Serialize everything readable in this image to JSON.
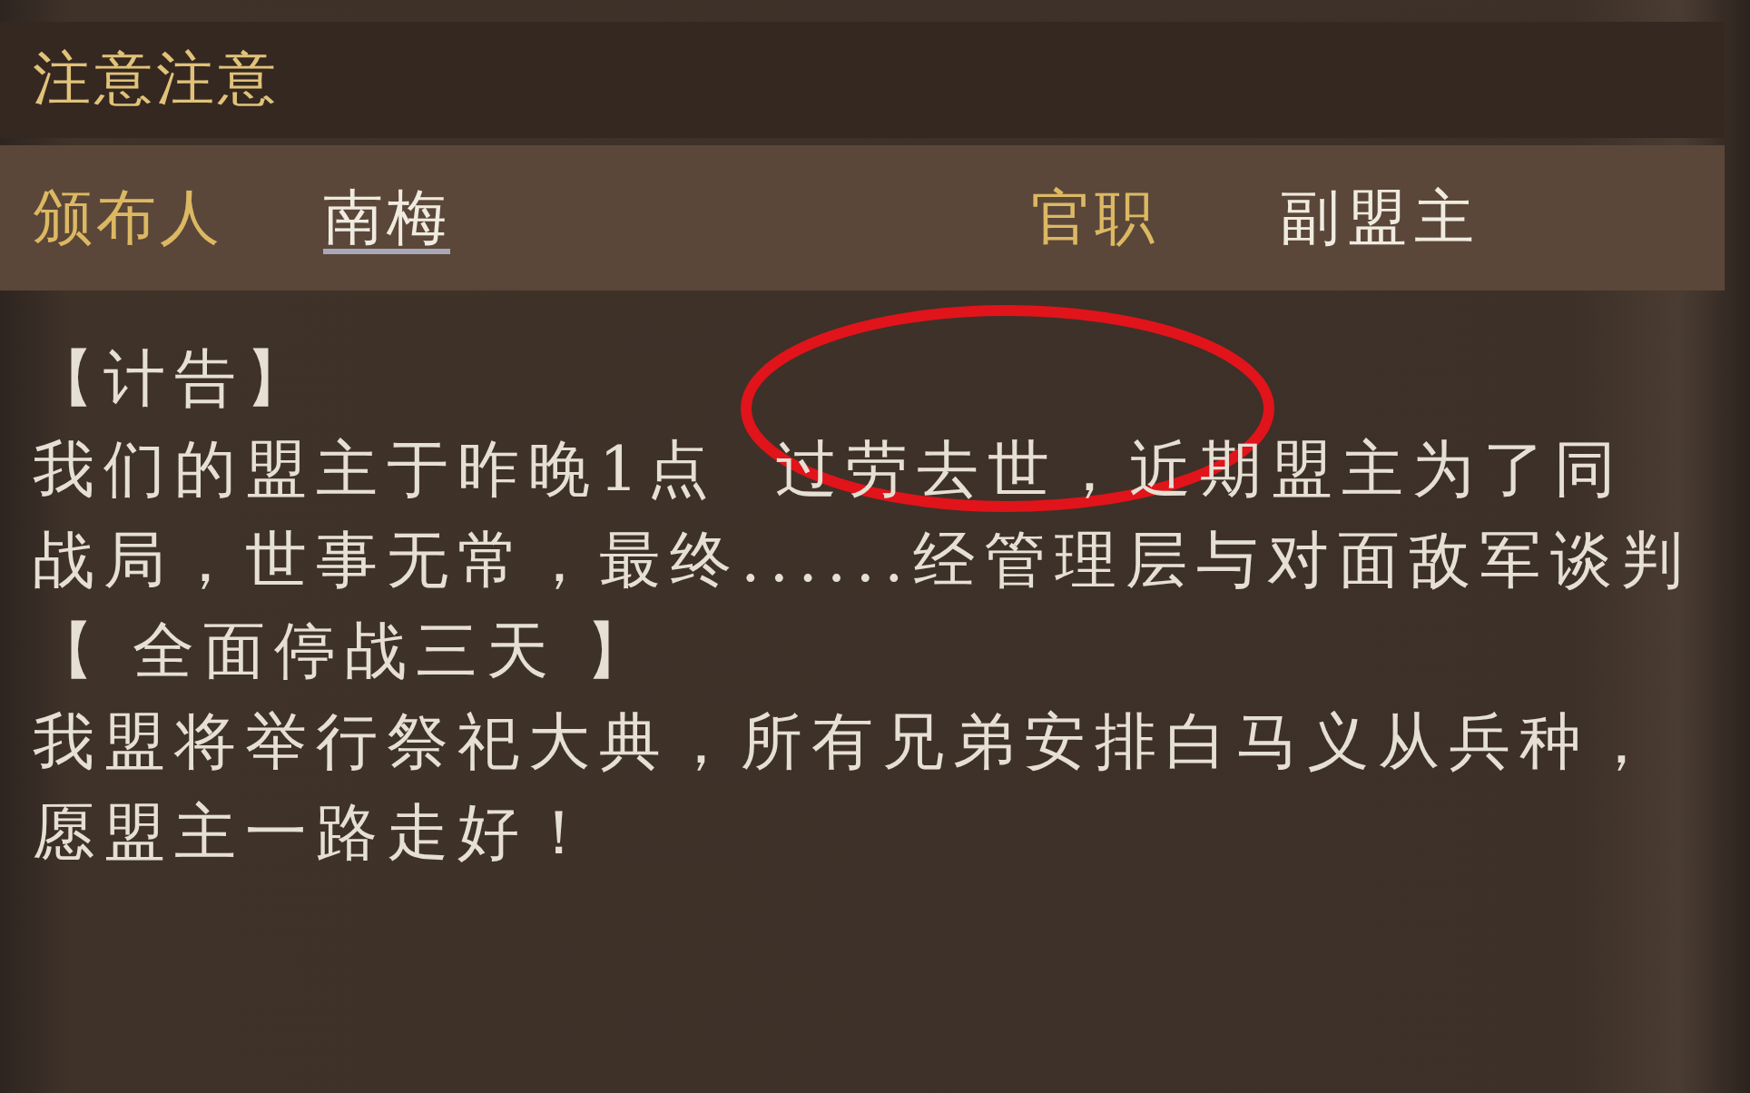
{
  "title": "注意注意",
  "info": {
    "issuer_label": "颁布人",
    "issuer": "南梅",
    "position_label": "官职",
    "position": "副盟主"
  },
  "body_lines": [
    "【计告】",
    "我们的盟主于昨晚1点  过劳去世，近期盟主为了同",
    "战局，世事无常，最终......经管理层与对面敌军谈判",
    "【 全面停战三天 】",
    "我盟将举行祭祀大典，所有兄弟安排白马义从兵种，",
    "愿盟主一路走好！"
  ]
}
